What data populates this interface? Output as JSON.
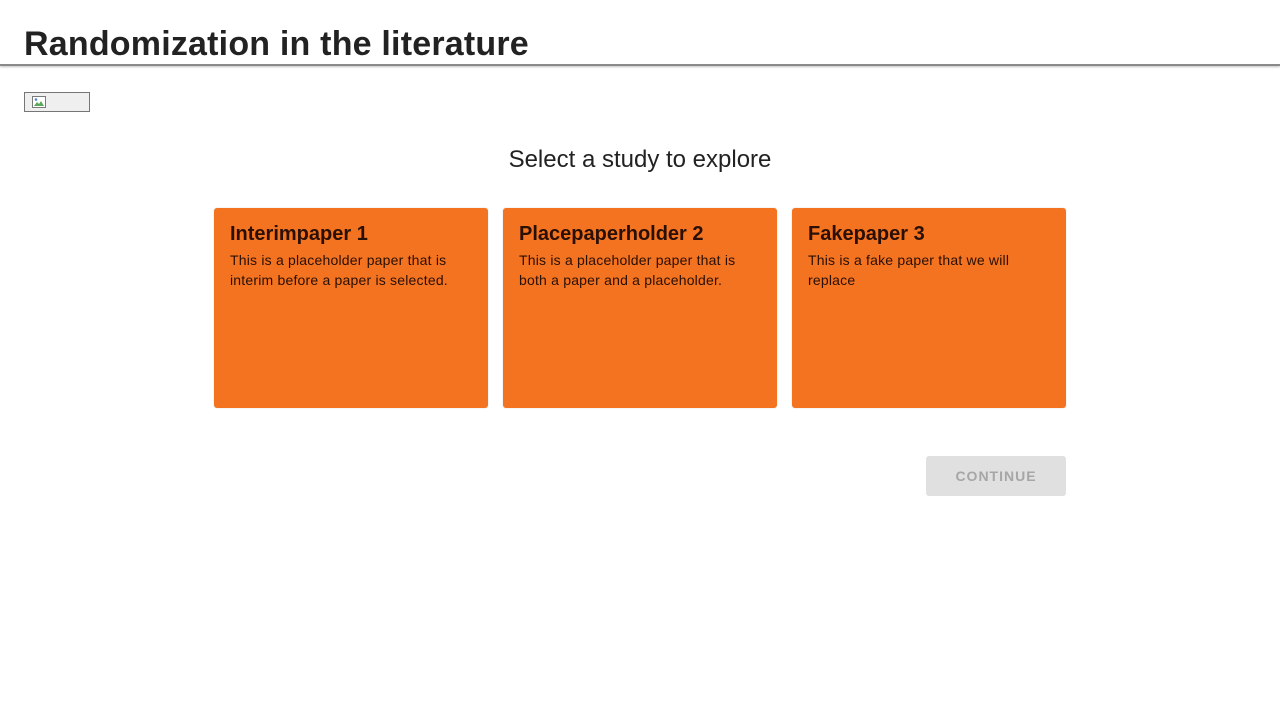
{
  "header": {
    "title": "Randomization in the literature"
  },
  "image_button": {
    "icon": "broken-image-icon"
  },
  "main": {
    "subtitle": "Select a study to explore",
    "cards": [
      {
        "title": "Interimpaper 1",
        "description": "This is a placeholder paper that is interim before a paper is selected."
      },
      {
        "title": "Placepaperholder 2",
        "description": "This is a placeholder paper that is both a paper and a placeholder."
      },
      {
        "title": "Fakepaper 3",
        "description": "This is a fake paper that we will replace"
      }
    ],
    "continue_label": "CONTINUE"
  },
  "colors": {
    "card_background": "#f37321",
    "card_text": "#2a0f05",
    "disabled_button_bg": "#e0e0e0",
    "disabled_button_text": "#a6a6a6"
  }
}
